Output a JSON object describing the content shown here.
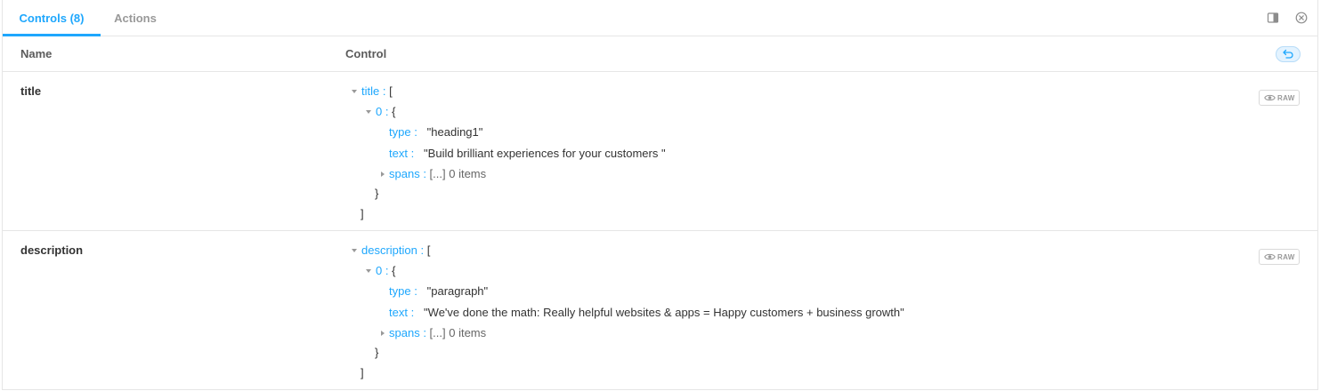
{
  "tabs": [
    {
      "label": "Controls (8)",
      "active": true
    },
    {
      "label": "Actions",
      "active": false
    }
  ],
  "table": {
    "headers": {
      "name": "Name",
      "control": "Control"
    }
  },
  "raw_label": "RAW",
  "rows": [
    {
      "name": "title",
      "root_key": "title",
      "open_bracket": "[",
      "index_key": "0",
      "open_brace": "{",
      "type_key": "type",
      "type_value": "\"heading1\"",
      "text_key": "text",
      "text_value": "\"Build brilliant experiences for your customers \"",
      "spans_key": "spans",
      "spans_value": "[...]",
      "spans_count": "0 items",
      "close_brace": "}",
      "close_bracket": "]"
    },
    {
      "name": "description",
      "root_key": "description",
      "open_bracket": "[",
      "index_key": "0",
      "open_brace": "{",
      "type_key": "type",
      "type_value": "\"paragraph\"",
      "text_key": "text",
      "text_value": "\"We've done the math: Really helpful websites & apps = Happy customers + business growth\"",
      "spans_key": "spans",
      "spans_value": "[...]",
      "spans_count": "0 items",
      "close_brace": "}",
      "close_bracket": "]"
    }
  ],
  "colors": {
    "accent": "#1ea7fd",
    "border": "#e6e6e6",
    "muted_text": "#999999"
  },
  "icons": {
    "split": "sidebar-toggle-icon",
    "close": "close-circle-icon",
    "reset": "undo-icon",
    "raw": "eye-icon"
  }
}
